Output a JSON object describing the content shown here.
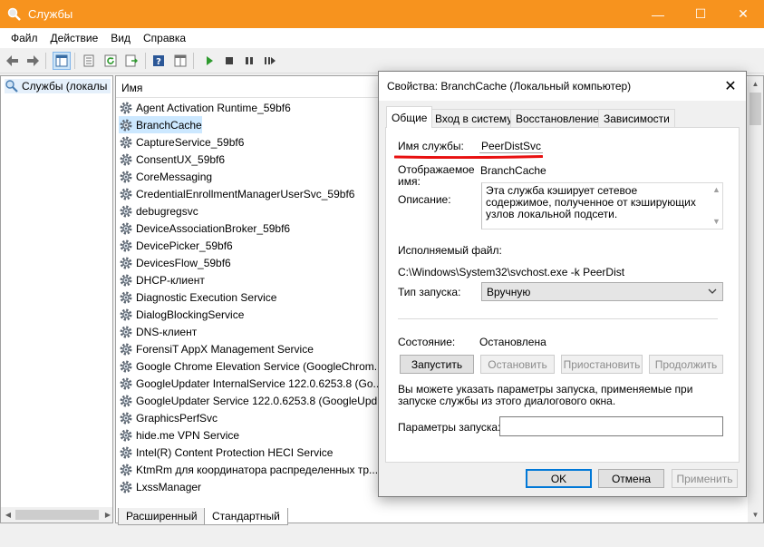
{
  "window": {
    "title": "Службы"
  },
  "menu": [
    "Файл",
    "Действие",
    "Вид",
    "Справка"
  ],
  "tree": {
    "root": "Службы (локалы"
  },
  "list": {
    "column": "Имя",
    "rows": [
      "Agent Activation Runtime_59bf6",
      "BranchCache",
      "CaptureService_59bf6",
      "ConsentUX_59bf6",
      "CoreMessaging",
      "CredentialEnrollmentManagerUserSvc_59bf6",
      "debugregsvc",
      "DeviceAssociationBroker_59bf6",
      "DevicePicker_59bf6",
      "DevicesFlow_59bf6",
      "DHCP-клиент",
      "Diagnostic Execution Service",
      "DialogBlockingService",
      "DNS-клиент",
      "ForensiT AppX Management Service",
      "Google Chrome Elevation Service (GoogleChrom...",
      "GoogleUpdater InternalService 122.0.6253.8 (Go...",
      "GoogleUpdater Service 122.0.6253.8 (GoogleUpd...",
      "GraphicsPerfSvc",
      "hide.me VPN Service",
      "Intel(R) Content Protection HECI Service",
      "KtmRm для координатора распределенных тр...",
      "LxssManager"
    ],
    "selected_index": 1
  },
  "bottom_tabs": [
    "Расширенный",
    "Стандартный"
  ],
  "dialog": {
    "title": "Свойства: BranchCache (Локальный компьютер)",
    "tabs": [
      "Общие",
      "Вход в систему",
      "Восстановление",
      "Зависимости"
    ],
    "service_name_label": "Имя службы:",
    "service_name": "PeerDistSvc",
    "display_name_label": "Отображаемое имя:",
    "display_name": "BranchCache",
    "description_label": "Описание:",
    "description": "Эта служба кэширует сетевое содержимое, полученное от кэширующих узлов локальной подсети.",
    "exe_label": "Исполняемый файл:",
    "exe_path": "C:\\Windows\\System32\\svchost.exe -k PeerDist",
    "startup_label": "Тип запуска:",
    "startup_value": "Вручную",
    "status_label": "Состояние:",
    "status_value": "Остановлена",
    "buttons": {
      "start": "Запустить",
      "stop": "Остановить",
      "pause": "Приостановить",
      "resume": "Продолжить"
    },
    "hint": "Вы можете указать параметры запуска, применяемые при запуске службы из этого диалогового окна.",
    "params_label": "Параметры запуска:",
    "params_value": "",
    "ok": "OK",
    "cancel": "Отмена",
    "apply": "Применить"
  },
  "colors": {
    "titlebar": "#f7931e",
    "selection": "#cce8ff",
    "annotation": "#e81010"
  }
}
